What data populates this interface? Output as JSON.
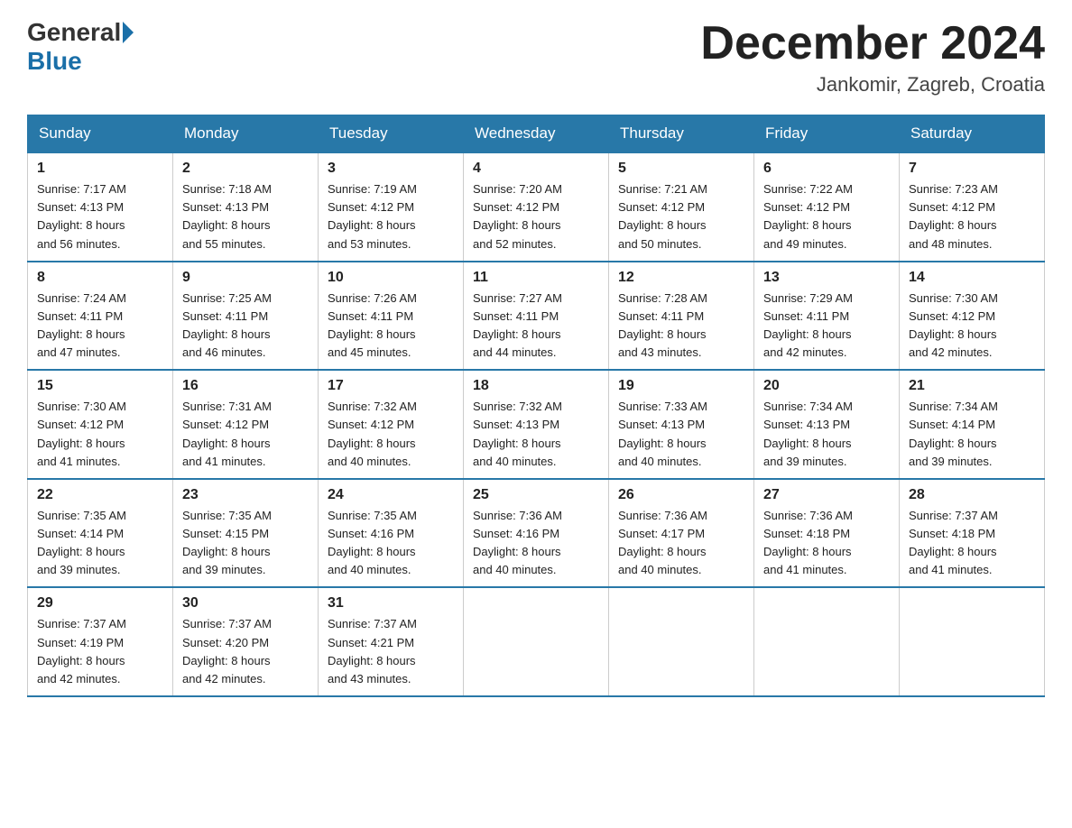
{
  "header": {
    "logo_general": "General",
    "logo_blue": "Blue",
    "month_title": "December 2024",
    "location": "Jankomir, Zagreb, Croatia"
  },
  "weekdays": [
    "Sunday",
    "Monday",
    "Tuesday",
    "Wednesday",
    "Thursday",
    "Friday",
    "Saturday"
  ],
  "weeks": [
    [
      {
        "day": "1",
        "sunrise": "7:17 AM",
        "sunset": "4:13 PM",
        "daylight": "8 hours and 56 minutes."
      },
      {
        "day": "2",
        "sunrise": "7:18 AM",
        "sunset": "4:13 PM",
        "daylight": "8 hours and 55 minutes."
      },
      {
        "day": "3",
        "sunrise": "7:19 AM",
        "sunset": "4:12 PM",
        "daylight": "8 hours and 53 minutes."
      },
      {
        "day": "4",
        "sunrise": "7:20 AM",
        "sunset": "4:12 PM",
        "daylight": "8 hours and 52 minutes."
      },
      {
        "day": "5",
        "sunrise": "7:21 AM",
        "sunset": "4:12 PM",
        "daylight": "8 hours and 50 minutes."
      },
      {
        "day": "6",
        "sunrise": "7:22 AM",
        "sunset": "4:12 PM",
        "daylight": "8 hours and 49 minutes."
      },
      {
        "day": "7",
        "sunrise": "7:23 AM",
        "sunset": "4:12 PM",
        "daylight": "8 hours and 48 minutes."
      }
    ],
    [
      {
        "day": "8",
        "sunrise": "7:24 AM",
        "sunset": "4:11 PM",
        "daylight": "8 hours and 47 minutes."
      },
      {
        "day": "9",
        "sunrise": "7:25 AM",
        "sunset": "4:11 PM",
        "daylight": "8 hours and 46 minutes."
      },
      {
        "day": "10",
        "sunrise": "7:26 AM",
        "sunset": "4:11 PM",
        "daylight": "8 hours and 45 minutes."
      },
      {
        "day": "11",
        "sunrise": "7:27 AM",
        "sunset": "4:11 PM",
        "daylight": "8 hours and 44 minutes."
      },
      {
        "day": "12",
        "sunrise": "7:28 AM",
        "sunset": "4:11 PM",
        "daylight": "8 hours and 43 minutes."
      },
      {
        "day": "13",
        "sunrise": "7:29 AM",
        "sunset": "4:11 PM",
        "daylight": "8 hours and 42 minutes."
      },
      {
        "day": "14",
        "sunrise": "7:30 AM",
        "sunset": "4:12 PM",
        "daylight": "8 hours and 42 minutes."
      }
    ],
    [
      {
        "day": "15",
        "sunrise": "7:30 AM",
        "sunset": "4:12 PM",
        "daylight": "8 hours and 41 minutes."
      },
      {
        "day": "16",
        "sunrise": "7:31 AM",
        "sunset": "4:12 PM",
        "daylight": "8 hours and 41 minutes."
      },
      {
        "day": "17",
        "sunrise": "7:32 AM",
        "sunset": "4:12 PM",
        "daylight": "8 hours and 40 minutes."
      },
      {
        "day": "18",
        "sunrise": "7:32 AM",
        "sunset": "4:13 PM",
        "daylight": "8 hours and 40 minutes."
      },
      {
        "day": "19",
        "sunrise": "7:33 AM",
        "sunset": "4:13 PM",
        "daylight": "8 hours and 40 minutes."
      },
      {
        "day": "20",
        "sunrise": "7:34 AM",
        "sunset": "4:13 PM",
        "daylight": "8 hours and 39 minutes."
      },
      {
        "day": "21",
        "sunrise": "7:34 AM",
        "sunset": "4:14 PM",
        "daylight": "8 hours and 39 minutes."
      }
    ],
    [
      {
        "day": "22",
        "sunrise": "7:35 AM",
        "sunset": "4:14 PM",
        "daylight": "8 hours and 39 minutes."
      },
      {
        "day": "23",
        "sunrise": "7:35 AM",
        "sunset": "4:15 PM",
        "daylight": "8 hours and 39 minutes."
      },
      {
        "day": "24",
        "sunrise": "7:35 AM",
        "sunset": "4:16 PM",
        "daylight": "8 hours and 40 minutes."
      },
      {
        "day": "25",
        "sunrise": "7:36 AM",
        "sunset": "4:16 PM",
        "daylight": "8 hours and 40 minutes."
      },
      {
        "day": "26",
        "sunrise": "7:36 AM",
        "sunset": "4:17 PM",
        "daylight": "8 hours and 40 minutes."
      },
      {
        "day": "27",
        "sunrise": "7:36 AM",
        "sunset": "4:18 PM",
        "daylight": "8 hours and 41 minutes."
      },
      {
        "day": "28",
        "sunrise": "7:37 AM",
        "sunset": "4:18 PM",
        "daylight": "8 hours and 41 minutes."
      }
    ],
    [
      {
        "day": "29",
        "sunrise": "7:37 AM",
        "sunset": "4:19 PM",
        "daylight": "8 hours and 42 minutes."
      },
      {
        "day": "30",
        "sunrise": "7:37 AM",
        "sunset": "4:20 PM",
        "daylight": "8 hours and 42 minutes."
      },
      {
        "day": "31",
        "sunrise": "7:37 AM",
        "sunset": "4:21 PM",
        "daylight": "8 hours and 43 minutes."
      },
      null,
      null,
      null,
      null
    ]
  ]
}
